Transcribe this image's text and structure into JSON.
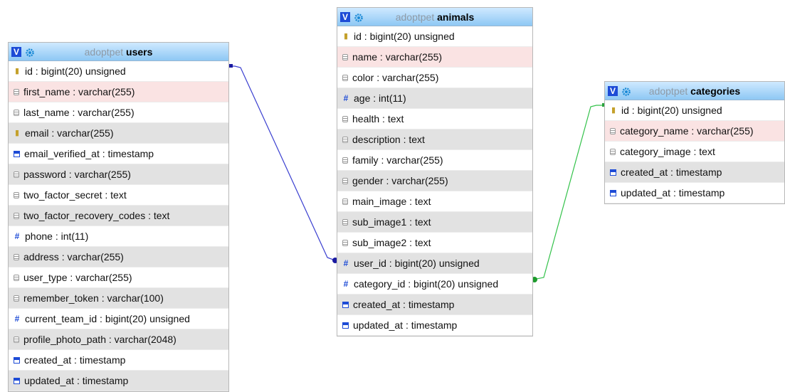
{
  "tables": {
    "users": {
      "db": "adoptpet",
      "name": "users",
      "columns": [
        {
          "label": "id : bigint(20) unsigned",
          "icon": "key-icon"
        },
        {
          "label": "first_name : varchar(255)",
          "icon": "text-field-icon"
        },
        {
          "label": "last_name : varchar(255)",
          "icon": "text-field-icon"
        },
        {
          "label": "email : varchar(255)",
          "icon": "key-icon"
        },
        {
          "label": "email_verified_at : timestamp",
          "icon": "calendar-icon"
        },
        {
          "label": "password : varchar(255)",
          "icon": "text-field-icon"
        },
        {
          "label": "two_factor_secret : text",
          "icon": "text-field-icon"
        },
        {
          "label": "two_factor_recovery_codes : text",
          "icon": "text-field-icon"
        },
        {
          "label": "phone : int(11)",
          "icon": "hash-icon"
        },
        {
          "label": "address : varchar(255)",
          "icon": "text-field-icon"
        },
        {
          "label": "user_type : varchar(255)",
          "icon": "text-field-icon"
        },
        {
          "label": "remember_token : varchar(100)",
          "icon": "text-field-icon"
        },
        {
          "label": "current_team_id : bigint(20) unsigned",
          "icon": "hash-icon"
        },
        {
          "label": "profile_photo_path : varchar(2048)",
          "icon": "text-field-icon"
        },
        {
          "label": "created_at : timestamp",
          "icon": "calendar-icon"
        },
        {
          "label": "updated_at : timestamp",
          "icon": "calendar-icon"
        }
      ]
    },
    "animals": {
      "db": "adoptpet",
      "name": "animals",
      "columns": [
        {
          "label": "id : bigint(20) unsigned",
          "icon": "key-icon"
        },
        {
          "label": "name : varchar(255)",
          "icon": "text-field-icon"
        },
        {
          "label": "color : varchar(255)",
          "icon": "text-field-icon"
        },
        {
          "label": "age : int(11)",
          "icon": "hash-icon"
        },
        {
          "label": "health : text",
          "icon": "text-field-icon"
        },
        {
          "label": "description : text",
          "icon": "text-field-icon"
        },
        {
          "label": "family : varchar(255)",
          "icon": "text-field-icon"
        },
        {
          "label": "gender : varchar(255)",
          "icon": "text-field-icon"
        },
        {
          "label": "main_image : text",
          "icon": "text-field-icon"
        },
        {
          "label": "sub_image1 : text",
          "icon": "text-field-icon"
        },
        {
          "label": "sub_image2 : text",
          "icon": "text-field-icon"
        },
        {
          "label": "user_id : bigint(20) unsigned",
          "icon": "hash-icon"
        },
        {
          "label": "category_id : bigint(20) unsigned",
          "icon": "hash-icon"
        },
        {
          "label": "created_at : timestamp",
          "icon": "calendar-icon"
        },
        {
          "label": "updated_at : timestamp",
          "icon": "calendar-icon"
        }
      ]
    },
    "categories": {
      "db": "adoptpet",
      "name": "categories",
      "columns": [
        {
          "label": "id : bigint(20) unsigned",
          "icon": "key-icon"
        },
        {
          "label": "category_name : varchar(255)",
          "icon": "text-field-icon"
        },
        {
          "label": "category_image : text",
          "icon": "text-field-icon"
        },
        {
          "label": "created_at : timestamp",
          "icon": "calendar-icon"
        },
        {
          "label": "updated_at : timestamp",
          "icon": "calendar-icon"
        }
      ]
    }
  },
  "header_badge": "V",
  "colors": {
    "header_top": "#cfe9ff",
    "header_bottom": "#8ec8f4",
    "row_even": "#e2e2e2",
    "row_highlight": "#fae3e3",
    "link_users": "#3a3fd0",
    "link_categories": "#33c24a",
    "badge": "#1d4bd6"
  },
  "relations": [
    {
      "from": "animals.user_id",
      "to": "users.id"
    },
    {
      "from": "animals.category_id",
      "to": "categories.id"
    }
  ]
}
